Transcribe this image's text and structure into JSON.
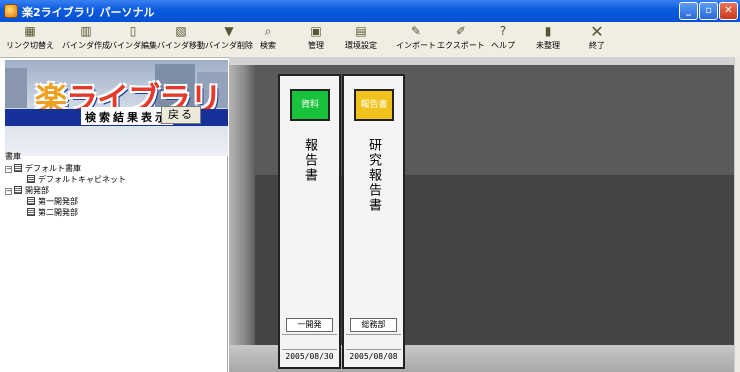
{
  "window": {
    "title": "楽2ライブラリ パーソナル",
    "controls": {
      "minimize": "_",
      "restore": "▫",
      "close": "✕"
    }
  },
  "toolbar": {
    "buttons": [
      {
        "label": "リンク切替え",
        "icon": "link-toggle-icon"
      },
      {
        "label": "バインダ作成",
        "icon": "binder-create-icon"
      },
      {
        "label": "バインダ編集",
        "icon": "binder-edit-icon"
      },
      {
        "label": "バインダ移動",
        "icon": "binder-move-icon"
      },
      {
        "label": "バインダ削除",
        "icon": "binder-delete-icon"
      },
      {
        "label": "検索",
        "icon": "search-icon"
      },
      {
        "label": "管理",
        "icon": "manage-icon"
      },
      {
        "label": "環境設定",
        "icon": "settings-icon"
      },
      {
        "label": "インポート",
        "icon": "import-icon"
      },
      {
        "label": "エクスポート",
        "icon": "export-icon"
      },
      {
        "label": "ヘルプ",
        "icon": "help-icon"
      },
      {
        "label": "未整理",
        "icon": "unsorted-icon"
      },
      {
        "label": "終了",
        "icon": "exit-icon"
      }
    ]
  },
  "left_pane": {
    "logo_text": "ライブラリ",
    "logo_kanji": "楽",
    "result_label": "検索結果表示",
    "back_button": "戻る",
    "tree": {
      "root": "書庫",
      "nodes": [
        {
          "label": "デフォルト書庫",
          "level": 1
        },
        {
          "label": "デフォルトキャビネット",
          "level": 2
        },
        {
          "label": "開発部",
          "level": 1
        },
        {
          "label": "第一開発部",
          "level": 2
        },
        {
          "label": "第二開発部",
          "level": 2
        }
      ]
    }
  },
  "shelf": {
    "binders": [
      {
        "label": "資料",
        "label_color": "#18c23a",
        "title": "報告書",
        "department": "一開発",
        "date": "2005/08/30"
      },
      {
        "label": "報告書",
        "label_color": "#f2c21c",
        "title": "研究報告書",
        "department": "総務部",
        "date": "2005/08/08"
      }
    ]
  }
}
